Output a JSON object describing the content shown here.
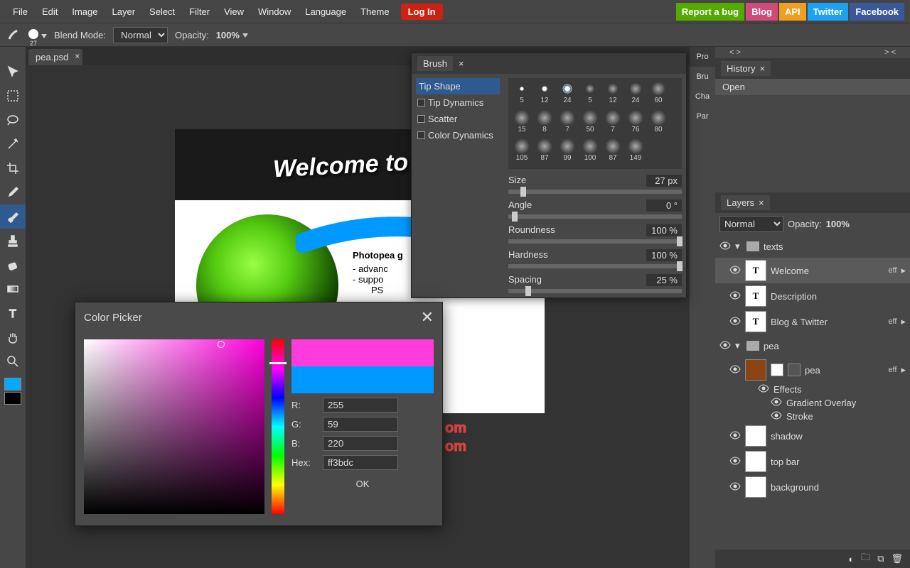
{
  "menu": {
    "items": [
      "File",
      "Edit",
      "Image",
      "Layer",
      "Select",
      "Filter",
      "View",
      "Window",
      "Language",
      "Theme"
    ],
    "login": "Log In",
    "ext": [
      {
        "k": "bug",
        "t": "Report a bug"
      },
      {
        "k": "blog",
        "t": "Blog"
      },
      {
        "k": "api",
        "t": "API"
      },
      {
        "k": "tw",
        "t": "Twitter"
      },
      {
        "k": "fb",
        "t": "Facebook"
      }
    ]
  },
  "optbar": {
    "size": "27",
    "blend_label": "Blend Mode:",
    "blend": "Normal",
    "opacity_label": "Opacity:",
    "opacity": "100%"
  },
  "tab": {
    "name": "pea.psd"
  },
  "doc": {
    "welcome": "Welcome to Ph",
    "headline": "Photopea g",
    "b1": "- advanc",
    "b2": "- suppo",
    "b3": "PS",
    "link1": "om",
    "link2": "om"
  },
  "brush": {
    "title": "Brush",
    "left": {
      "tipshape": "Tip Shape",
      "tipdyn": "Tip Dynamics",
      "scatter": "Scatter",
      "colordyn": "Color Dynamics"
    },
    "tips": [
      "5",
      "12",
      "24",
      "5",
      "12",
      "24",
      "60",
      "15",
      "8",
      "7",
      "50",
      "7",
      "76",
      "80",
      "105",
      "87",
      "99",
      "100",
      "87",
      "149"
    ],
    "sel_tip": 2,
    "sliders": [
      {
        "name": "Size",
        "val": "27 px",
        "pos": 7
      },
      {
        "name": "Angle",
        "val": "0 °",
        "pos": 2
      },
      {
        "name": "Roundness",
        "val": "100 %",
        "pos": 97
      },
      {
        "name": "Hardness",
        "val": "100 %",
        "pos": 97
      },
      {
        "name": "Spacing",
        "val": "25 %",
        "pos": 10
      }
    ]
  },
  "colorpicker": {
    "title": "Color Picker",
    "r": "255",
    "g": "59",
    "b": "220",
    "hex": "ff3bdc",
    "ok": "OK",
    "labels": {
      "r": "R:",
      "g": "G:",
      "b": "B:",
      "hex": "Hex:"
    }
  },
  "sidetabs": [
    "Pro",
    "Bru",
    "Cha",
    "Par"
  ],
  "history": {
    "title": "History",
    "items": [
      "Open"
    ]
  },
  "layers": {
    "title": "Layers",
    "blend": "Normal",
    "opacity_label": "Opacity:",
    "opacity": "100%",
    "tree": [
      {
        "type": "folder",
        "name": "texts",
        "open": true,
        "children": [
          {
            "type": "text",
            "name": "Welcome",
            "eff": true,
            "sel": true
          },
          {
            "type": "text",
            "name": "Description"
          },
          {
            "type": "text",
            "name": "Blog & Twitter",
            "eff": true
          }
        ]
      },
      {
        "type": "folder",
        "name": "pea",
        "open": true,
        "children": [
          {
            "type": "img",
            "name": "pea",
            "eff": true,
            "thumb": "#8b4513",
            "mask": true,
            "effects_open": true,
            "effects": [
              "Gradient Overlay",
              "Stroke"
            ]
          },
          {
            "type": "img",
            "name": "shadow",
            "thumb": "trans"
          },
          {
            "type": "img",
            "name": "top bar",
            "thumb": "trans"
          },
          {
            "type": "img",
            "name": "background",
            "thumb": "#fff"
          }
        ]
      }
    ],
    "effects_label": "Effects"
  },
  "swatch": {
    "fg": "#0af",
    "bg": "#000"
  }
}
